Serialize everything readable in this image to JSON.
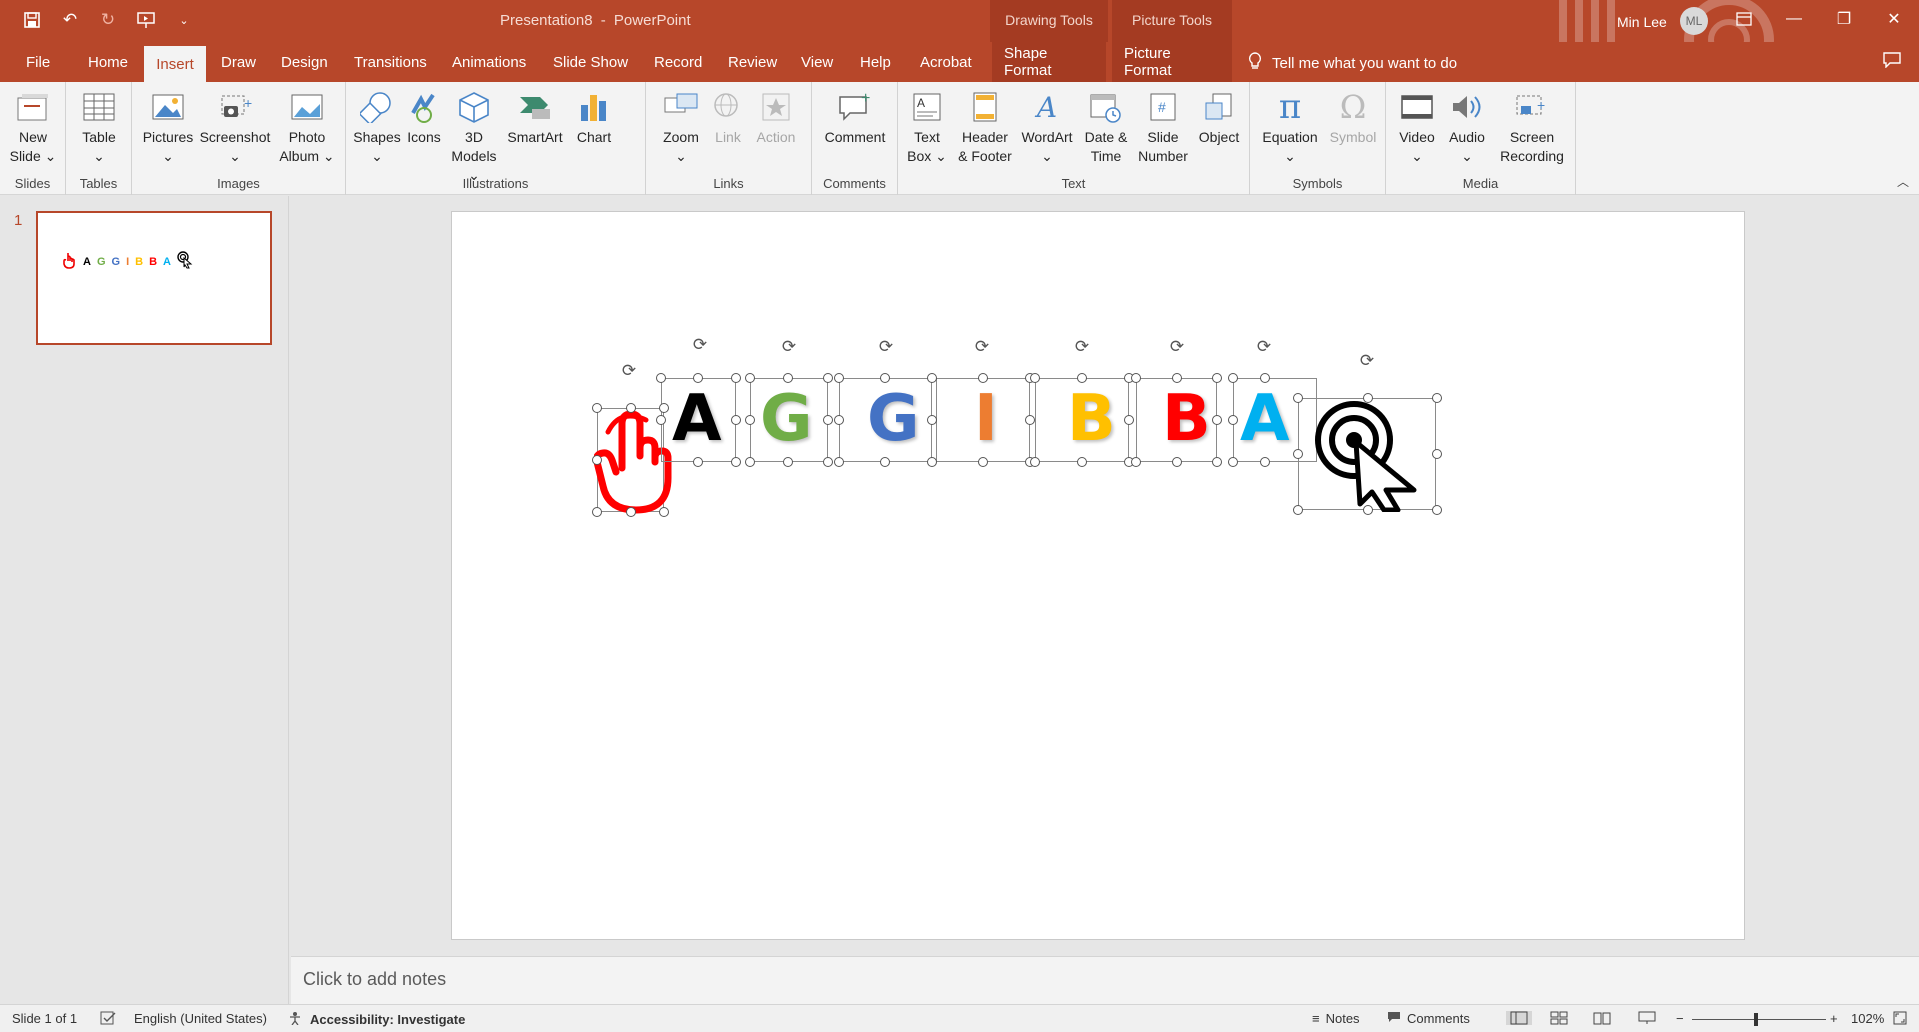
{
  "title_bar": {
    "document": "Presentation8",
    "separator": "-",
    "app": "PowerPoint",
    "user_name": "Min Lee",
    "user_initials": "ML",
    "context_groups": [
      "Drawing Tools",
      "Picture Tools"
    ]
  },
  "tabs": [
    "File",
    "Home",
    "Insert",
    "Draw",
    "Design",
    "Transitions",
    "Animations",
    "Slide Show",
    "Record",
    "Review",
    "View",
    "Help",
    "Acrobat",
    "Shape Format",
    "Picture Format"
  ],
  "active_tab": "Insert",
  "tell_me": "Tell me what you want to do",
  "ribbon": {
    "groups": {
      "slides": "Slides",
      "tables": "Tables",
      "images": "Images",
      "illustrations": "Illustrations",
      "links": "Links",
      "comments": "Comments",
      "text": "Text",
      "symbols": "Symbols",
      "media": "Media"
    },
    "buttons": {
      "new_slide": [
        "New",
        "Slide ⌄"
      ],
      "table": [
        "Table",
        "⌄"
      ],
      "pictures": [
        "Pictures",
        "⌄"
      ],
      "screenshot": [
        "Screenshot",
        "⌄"
      ],
      "photo_album": [
        "Photo",
        "Album ⌄"
      ],
      "shapes": [
        "Shapes",
        "⌄"
      ],
      "icons": [
        "Icons"
      ],
      "models": [
        "3D",
        "Models ⌄"
      ],
      "smartart": [
        "SmartArt"
      ],
      "chart": [
        "Chart"
      ],
      "zoom": [
        "Zoom",
        "⌄"
      ],
      "link": [
        "Link"
      ],
      "action": [
        "Action"
      ],
      "comment": [
        "Comment"
      ],
      "text_box": [
        "Text",
        "Box ⌄"
      ],
      "header_footer": [
        "Header",
        "& Footer"
      ],
      "wordart": [
        "WordArt",
        "⌄"
      ],
      "date_time": [
        "Date &",
        "Time"
      ],
      "slide_number": [
        "Slide",
        "Number"
      ],
      "object": [
        "Object"
      ],
      "equation": [
        "Equation",
        "⌄"
      ],
      "symbol": [
        "Symbol"
      ],
      "video": [
        "Video",
        "⌄"
      ],
      "audio": [
        "Audio",
        "⌄"
      ],
      "screen_recording": [
        "Screen",
        "Recording"
      ]
    }
  },
  "thumbnail": {
    "number": "1",
    "letters": [
      "A",
      "G",
      "G",
      "I",
      "B",
      "B",
      "A"
    ]
  },
  "slide": {
    "letters": [
      {
        "char": "A",
        "color": "#000000"
      },
      {
        "char": "G",
        "color": "#70ad47"
      },
      {
        "char": "G",
        "color": "#4472c4"
      },
      {
        "char": "I",
        "color": "#ed7d31"
      },
      {
        "char": "B",
        "color": "#ffc000"
      },
      {
        "char": "B",
        "color": "#ff0000"
      },
      {
        "char": "A",
        "color": "#00b0f0"
      }
    ],
    "icons": {
      "left": "hand-pointer-icon",
      "right": "click-cursor-icon"
    },
    "accent": "#b7472a"
  },
  "notes_placeholder": "Click to add notes",
  "status": {
    "slide_info": "Slide 1 of 1",
    "language": "English (United States)",
    "accessibility": "Accessibility: Investigate",
    "notes": "Notes",
    "comments": "Comments",
    "zoom": "102%"
  }
}
